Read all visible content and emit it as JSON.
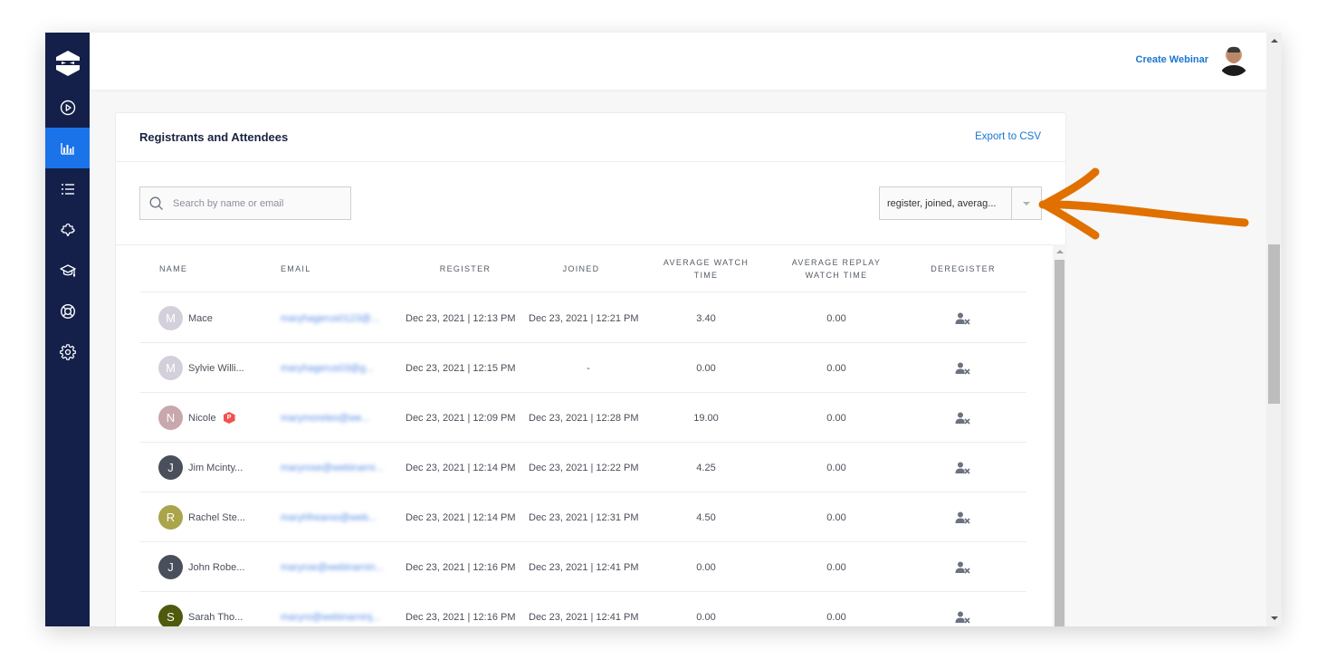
{
  "sidebar": {
    "logo": "ninja-logo-icon",
    "items": [
      {
        "icon": "play-circle-icon",
        "label": "Webinars",
        "active": false
      },
      {
        "icon": "bar-chart-icon",
        "label": "Analytics",
        "active": true
      },
      {
        "icon": "list-icon",
        "label": "Lists",
        "active": false
      },
      {
        "icon": "puzzle-icon",
        "label": "Integrations",
        "active": false
      },
      {
        "icon": "graduation-cap-icon",
        "label": "Learning",
        "active": false
      },
      {
        "icon": "lifebuoy-icon",
        "label": "Support",
        "active": false
      },
      {
        "icon": "gear-icon",
        "label": "Settings",
        "active": false
      }
    ]
  },
  "topbar": {
    "create_label": "Create Webinar",
    "avatar": "user-avatar"
  },
  "card": {
    "title": "Registrants and Attendees",
    "export_label": "Export to CSV",
    "search": {
      "placeholder": "Search by name or email",
      "value": ""
    },
    "columns_select": {
      "value": "register, joined, averag..."
    }
  },
  "table": {
    "headers": {
      "name": "NAME",
      "email": "EMAIL",
      "register": "REGISTER",
      "joined": "JOINED",
      "avg_watch_1": "AVERAGE WATCH",
      "avg_watch_2": "TIME",
      "avg_replay_1": "AVERAGE REPLAY",
      "avg_replay_2": "WATCH TIME",
      "deregister": "DEREGISTER"
    },
    "rows": [
      {
        "initial": "M",
        "avatar_color": "#d3d0db",
        "name": "Mace",
        "badge": "",
        "email": "maryhagerus0123@...",
        "register": "Dec 23, 2021 | 12:13 PM",
        "joined": "Dec 23, 2021 | 12:21 PM",
        "avg_watch": "3.40",
        "avg_replay": "0.00"
      },
      {
        "initial": "M",
        "avatar_color": "#d3d0db",
        "name": "Sylvie Willi...",
        "badge": "",
        "email": "maryhagerus03@g...",
        "register": "Dec 23, 2021 | 12:15 PM",
        "joined": "-",
        "avg_watch": "0.00",
        "avg_replay": "0.00"
      },
      {
        "initial": "N",
        "avatar_color": "#c8a8ad",
        "name": "Nicole",
        "badge": "P",
        "email": "marymoreleo@we...",
        "register": "Dec 23, 2021 | 12:09 PM",
        "joined": "Dec 23, 2021 | 12:28 PM",
        "avg_watch": "19.00",
        "avg_replay": "0.00"
      },
      {
        "initial": "J",
        "avatar_color": "#4a4f5c",
        "name": "Jim Mcinty...",
        "badge": "",
        "email": "maryrose@webinarni...",
        "register": "Dec 23, 2021 | 12:14 PM",
        "joined": "Dec 23, 2021 | 12:22 PM",
        "avg_watch": "4.25",
        "avg_replay": "0.00"
      },
      {
        "initial": "R",
        "avatar_color": "#aaa44a",
        "name": "Rachel Ste...",
        "badge": "",
        "email": "maryhfrearoo@web...",
        "register": "Dec 23, 2021 | 12:14 PM",
        "joined": "Dec 23, 2021 | 12:31 PM",
        "avg_watch": "4.50",
        "avg_replay": "0.00"
      },
      {
        "initial": "J",
        "avatar_color": "#4a4f5c",
        "name": "John Robe...",
        "badge": "",
        "email": "maryroe@webinarnin...",
        "register": "Dec 23, 2021 | 12:16 PM",
        "joined": "Dec 23, 2021 | 12:41 PM",
        "avg_watch": "0.00",
        "avg_replay": "0.00"
      },
      {
        "initial": "S",
        "avatar_color": "#4f5a0e",
        "name": "Sarah Tho...",
        "badge": "",
        "email": "maryro@webinarninj...",
        "register": "Dec 23, 2021 | 12:16 PM",
        "joined": "Dec 23, 2021 | 12:41 PM",
        "avg_watch": "0.00",
        "avg_replay": "0.00"
      }
    ]
  },
  "annotation": {
    "type": "arrow",
    "color": "#e07000",
    "points_to": "columns-select"
  },
  "colors": {
    "sidebar": "#14204a",
    "accent": "#1a73e8",
    "link": "#1976d2"
  }
}
